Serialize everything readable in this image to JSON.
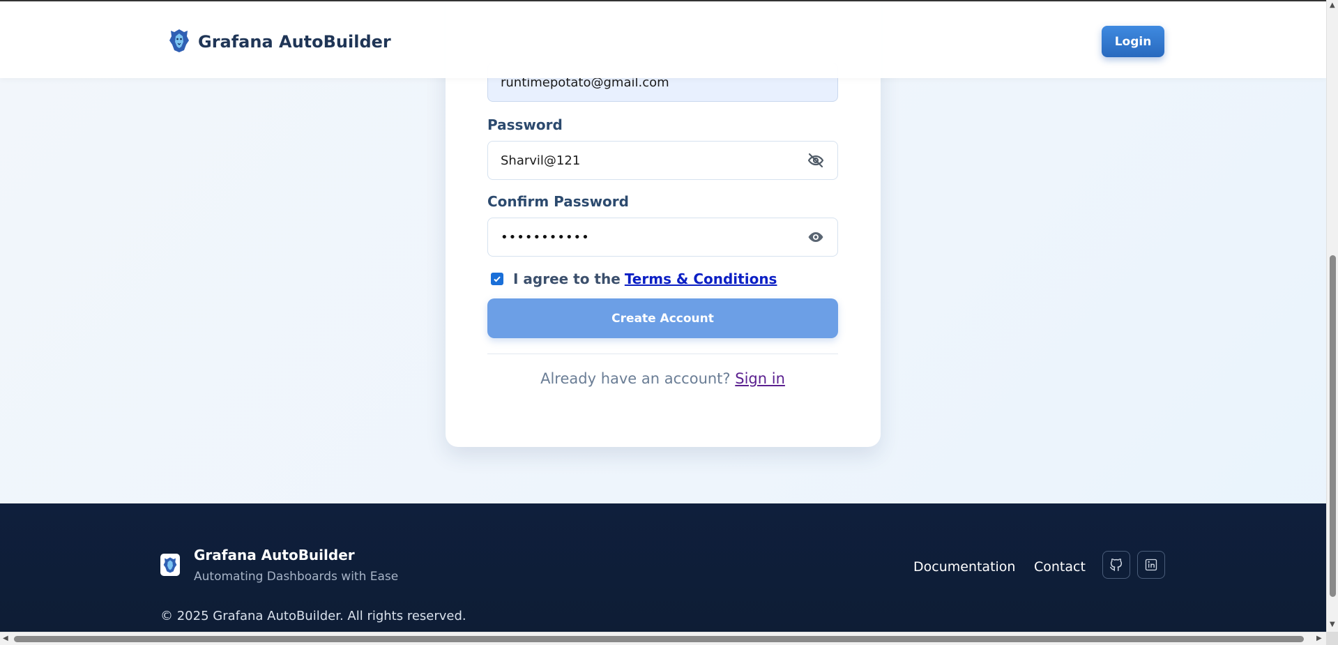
{
  "header": {
    "brand_name": "Grafana AutoBuilder",
    "login_label": "Login"
  },
  "form": {
    "email_value": "runtimepotato@gmail.com",
    "password_label": "Password",
    "password_value": "Sharvil@121",
    "confirm_label": "Confirm Password",
    "confirm_value": "•••••••••••",
    "agree_text": "I agree to the",
    "terms_link": "Terms & Conditions",
    "terms_checked": true,
    "create_label": "Create Account",
    "signin_prompt": "Already have an account?",
    "signin_link": "Sign in"
  },
  "footer": {
    "brand_name": "Grafana AutoBuilder",
    "tagline": "Automating Dashboards with Ease",
    "links": [
      "Documentation",
      "Contact"
    ],
    "copyright": "© 2025 Grafana AutoBuilder. All rights reserved."
  },
  "colors": {
    "accent": "#2869be",
    "create_button": "#6c9fe6",
    "footer_bg": "#0f1f3c"
  }
}
